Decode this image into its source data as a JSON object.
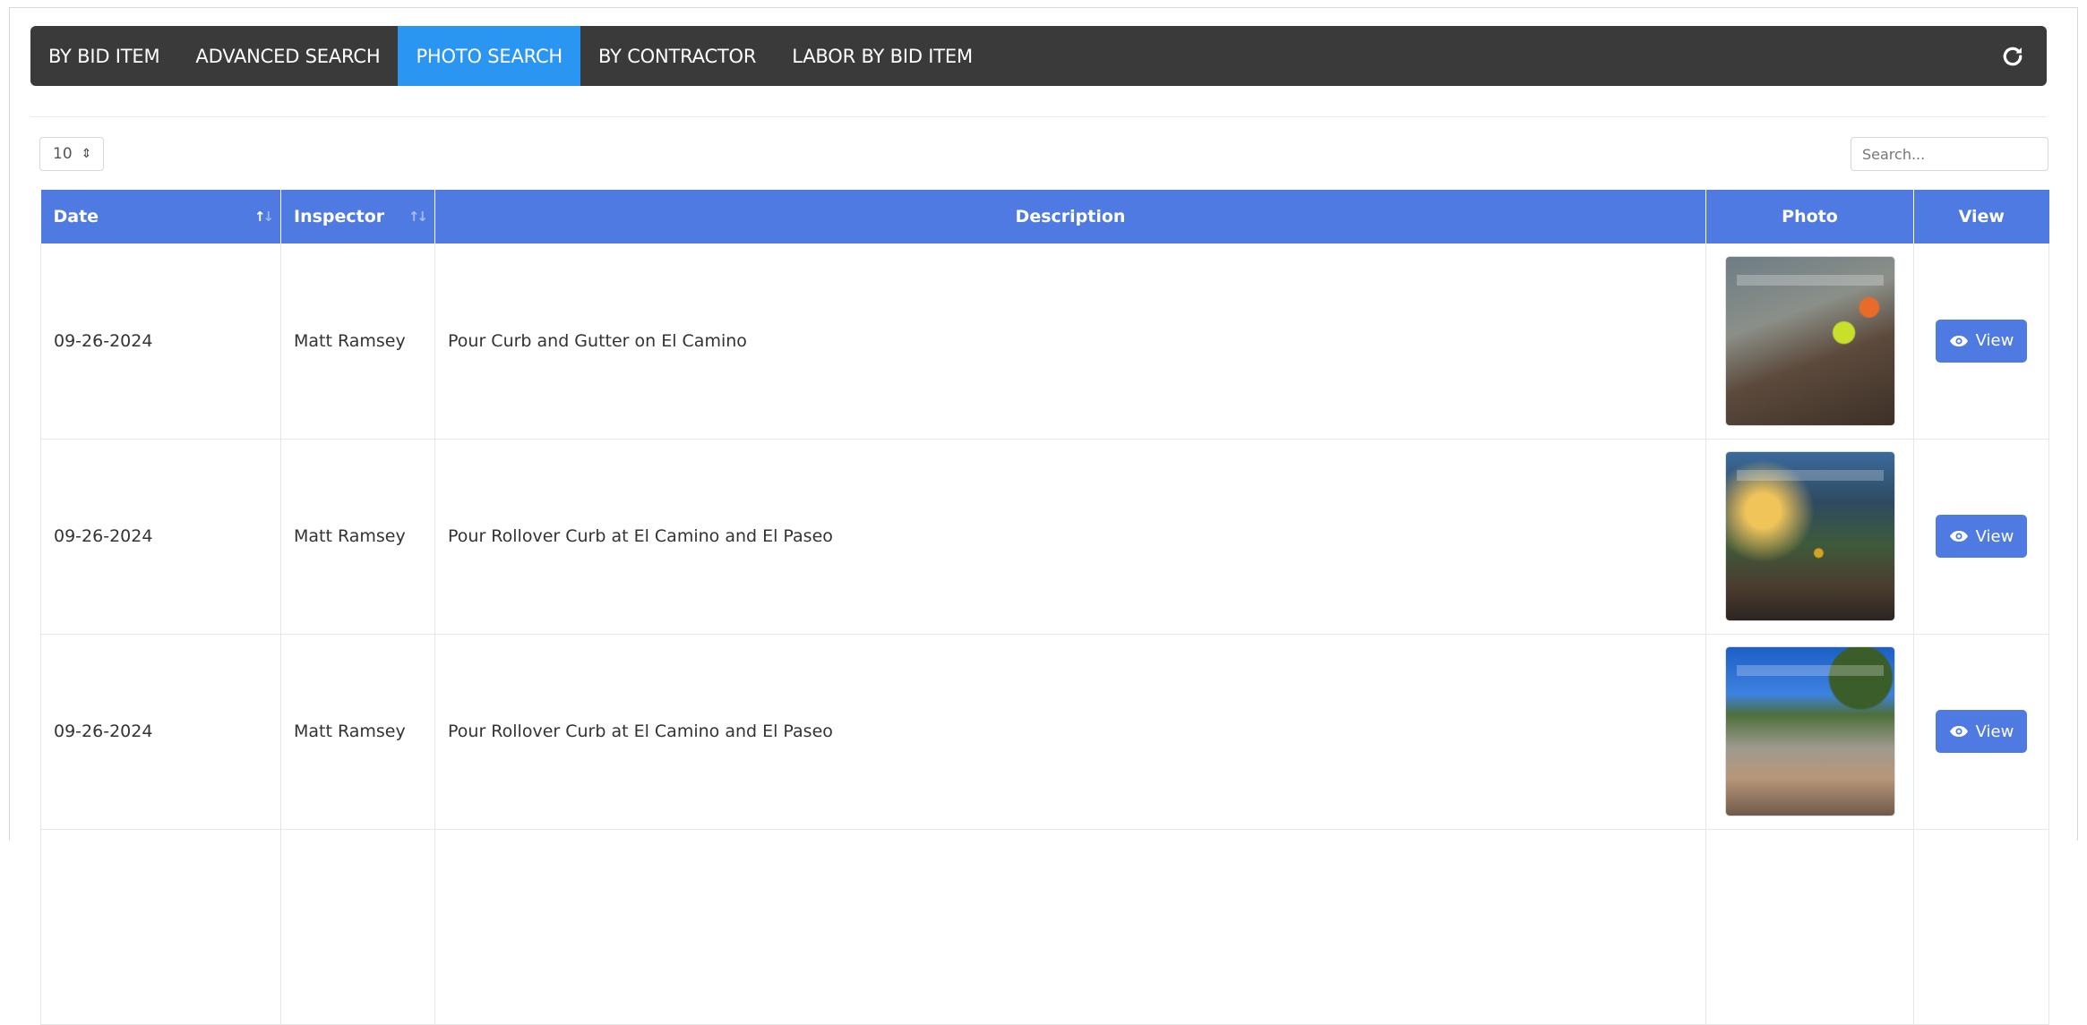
{
  "nav": {
    "tabs": [
      {
        "label": "BY BID ITEM",
        "active": false
      },
      {
        "label": "ADVANCED SEARCH",
        "active": false
      },
      {
        "label": "PHOTO SEARCH",
        "active": true
      },
      {
        "label": "BY CONTRACTOR",
        "active": false
      },
      {
        "label": "LABOR BY BID ITEM",
        "active": false
      }
    ],
    "refresh_icon": "refresh-icon"
  },
  "controls": {
    "page_length": "10",
    "search_placeholder": "Search..."
  },
  "table": {
    "headers": {
      "date": "Date",
      "inspector": "Inspector",
      "description": "Description",
      "photo": "Photo",
      "view": "View"
    },
    "rows": [
      {
        "date": "09-26-2024",
        "inspector": "Matt Ramsey",
        "description": "Pour Curb and Gutter on El Camino",
        "view_label": "View"
      },
      {
        "date": "09-26-2024",
        "inspector": "Matt Ramsey",
        "description": "Pour Rollover Curb at El Camino and El Paseo",
        "view_label": "View"
      },
      {
        "date": "09-26-2024",
        "inspector": "Matt Ramsey",
        "description": "Pour Rollover Curb at El Camino and El Paseo",
        "view_label": "View"
      }
    ]
  },
  "colors": {
    "nav_bg": "#3a3a3a",
    "nav_active": "#2b95f2",
    "header_bg": "#4f7ae2",
    "button_bg": "#4f7ae2"
  }
}
